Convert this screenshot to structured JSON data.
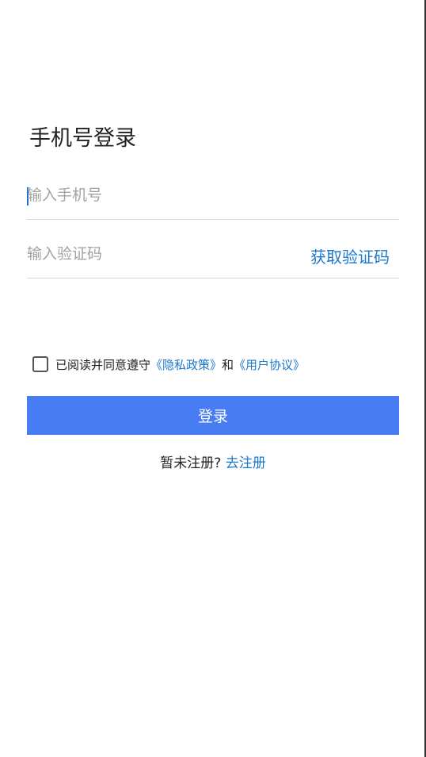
{
  "header": {
    "title": "手机号登录"
  },
  "form": {
    "phone_placeholder": "输入手机号",
    "phone_value": "",
    "code_placeholder": "输入验证码",
    "code_value": "",
    "get_code_label": "获取验证码"
  },
  "agreement": {
    "checked": false,
    "prefix": "已阅读并同意遵守",
    "privacy_link": "《隐私政策》",
    "connector": "和",
    "terms_link": "《用户协议》"
  },
  "login_button_label": "登录",
  "register": {
    "prompt": "暂未注册? ",
    "link": "去注册"
  },
  "colors": {
    "accent": "#487cf2",
    "link": "#1b78cf"
  }
}
